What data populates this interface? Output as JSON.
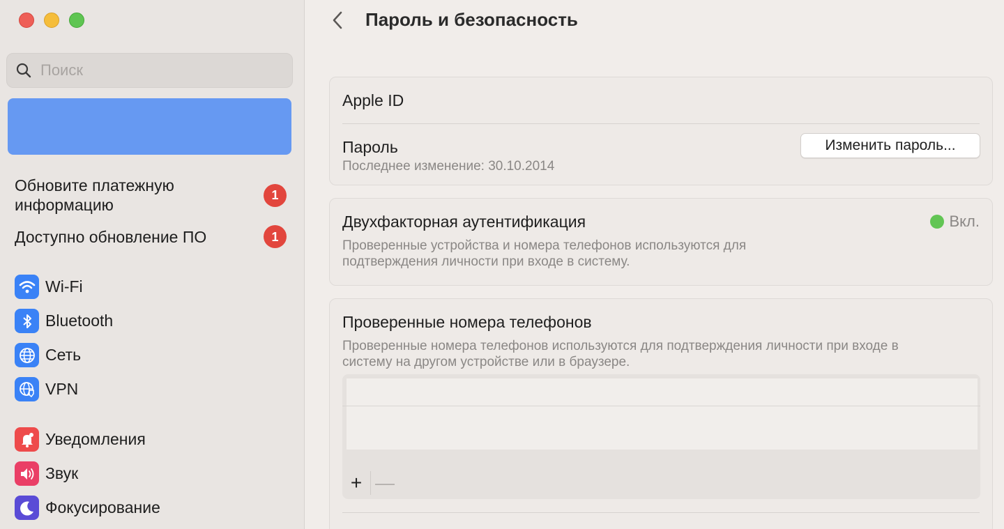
{
  "window": {
    "traffic_lights": [
      "close",
      "minimize",
      "zoom"
    ],
    "colors": {
      "close": "#ee5f57",
      "minimize": "#f5bd3b",
      "zoom": "#5fc552"
    }
  },
  "sidebar": {
    "search": {
      "placeholder": "Поиск",
      "value": ""
    },
    "account_card_color": "#6699f2",
    "notices": [
      {
        "label": "Обновите платежную информацию",
        "badge": "1"
      },
      {
        "label": "Доступно обновление ПО",
        "badge": "1"
      }
    ],
    "items": [
      {
        "label": "Wi-Fi",
        "icon": "wifi-icon"
      },
      {
        "label": "Bluetooth",
        "icon": "bluetooth-icon"
      },
      {
        "label": "Сеть",
        "icon": "globe-icon"
      },
      {
        "label": "VPN",
        "icon": "vpn-globe-icon"
      },
      {
        "label": "Уведомления",
        "icon": "bell-icon"
      },
      {
        "label": "Звук",
        "icon": "speaker-icon"
      },
      {
        "label": "Фокусирование",
        "icon": "moon-icon"
      }
    ]
  },
  "main": {
    "title": "Пароль и безопасность",
    "apple_id": {
      "label": "Apple ID"
    },
    "password": {
      "label": "Пароль",
      "last_changed": "Последнее изменение: 30.10.2014",
      "change_button": "Изменить пароль..."
    },
    "two_factor": {
      "label": "Двухфакторная аутентификация",
      "status": "Вкл.",
      "status_color": "#62c554",
      "description_line1": "Проверенные устройства и номера телефонов используются для",
      "description_line2": "подтверждения личности при входе в систему."
    },
    "trusted_phones": {
      "label": "Проверенные номера телефонов",
      "description_line1": "Проверенные номера телефонов используются для подтверждения личности при входе в",
      "description_line2": "систему на другом устройстве или в браузере.",
      "add_button": "+",
      "remove_button": "—"
    }
  }
}
